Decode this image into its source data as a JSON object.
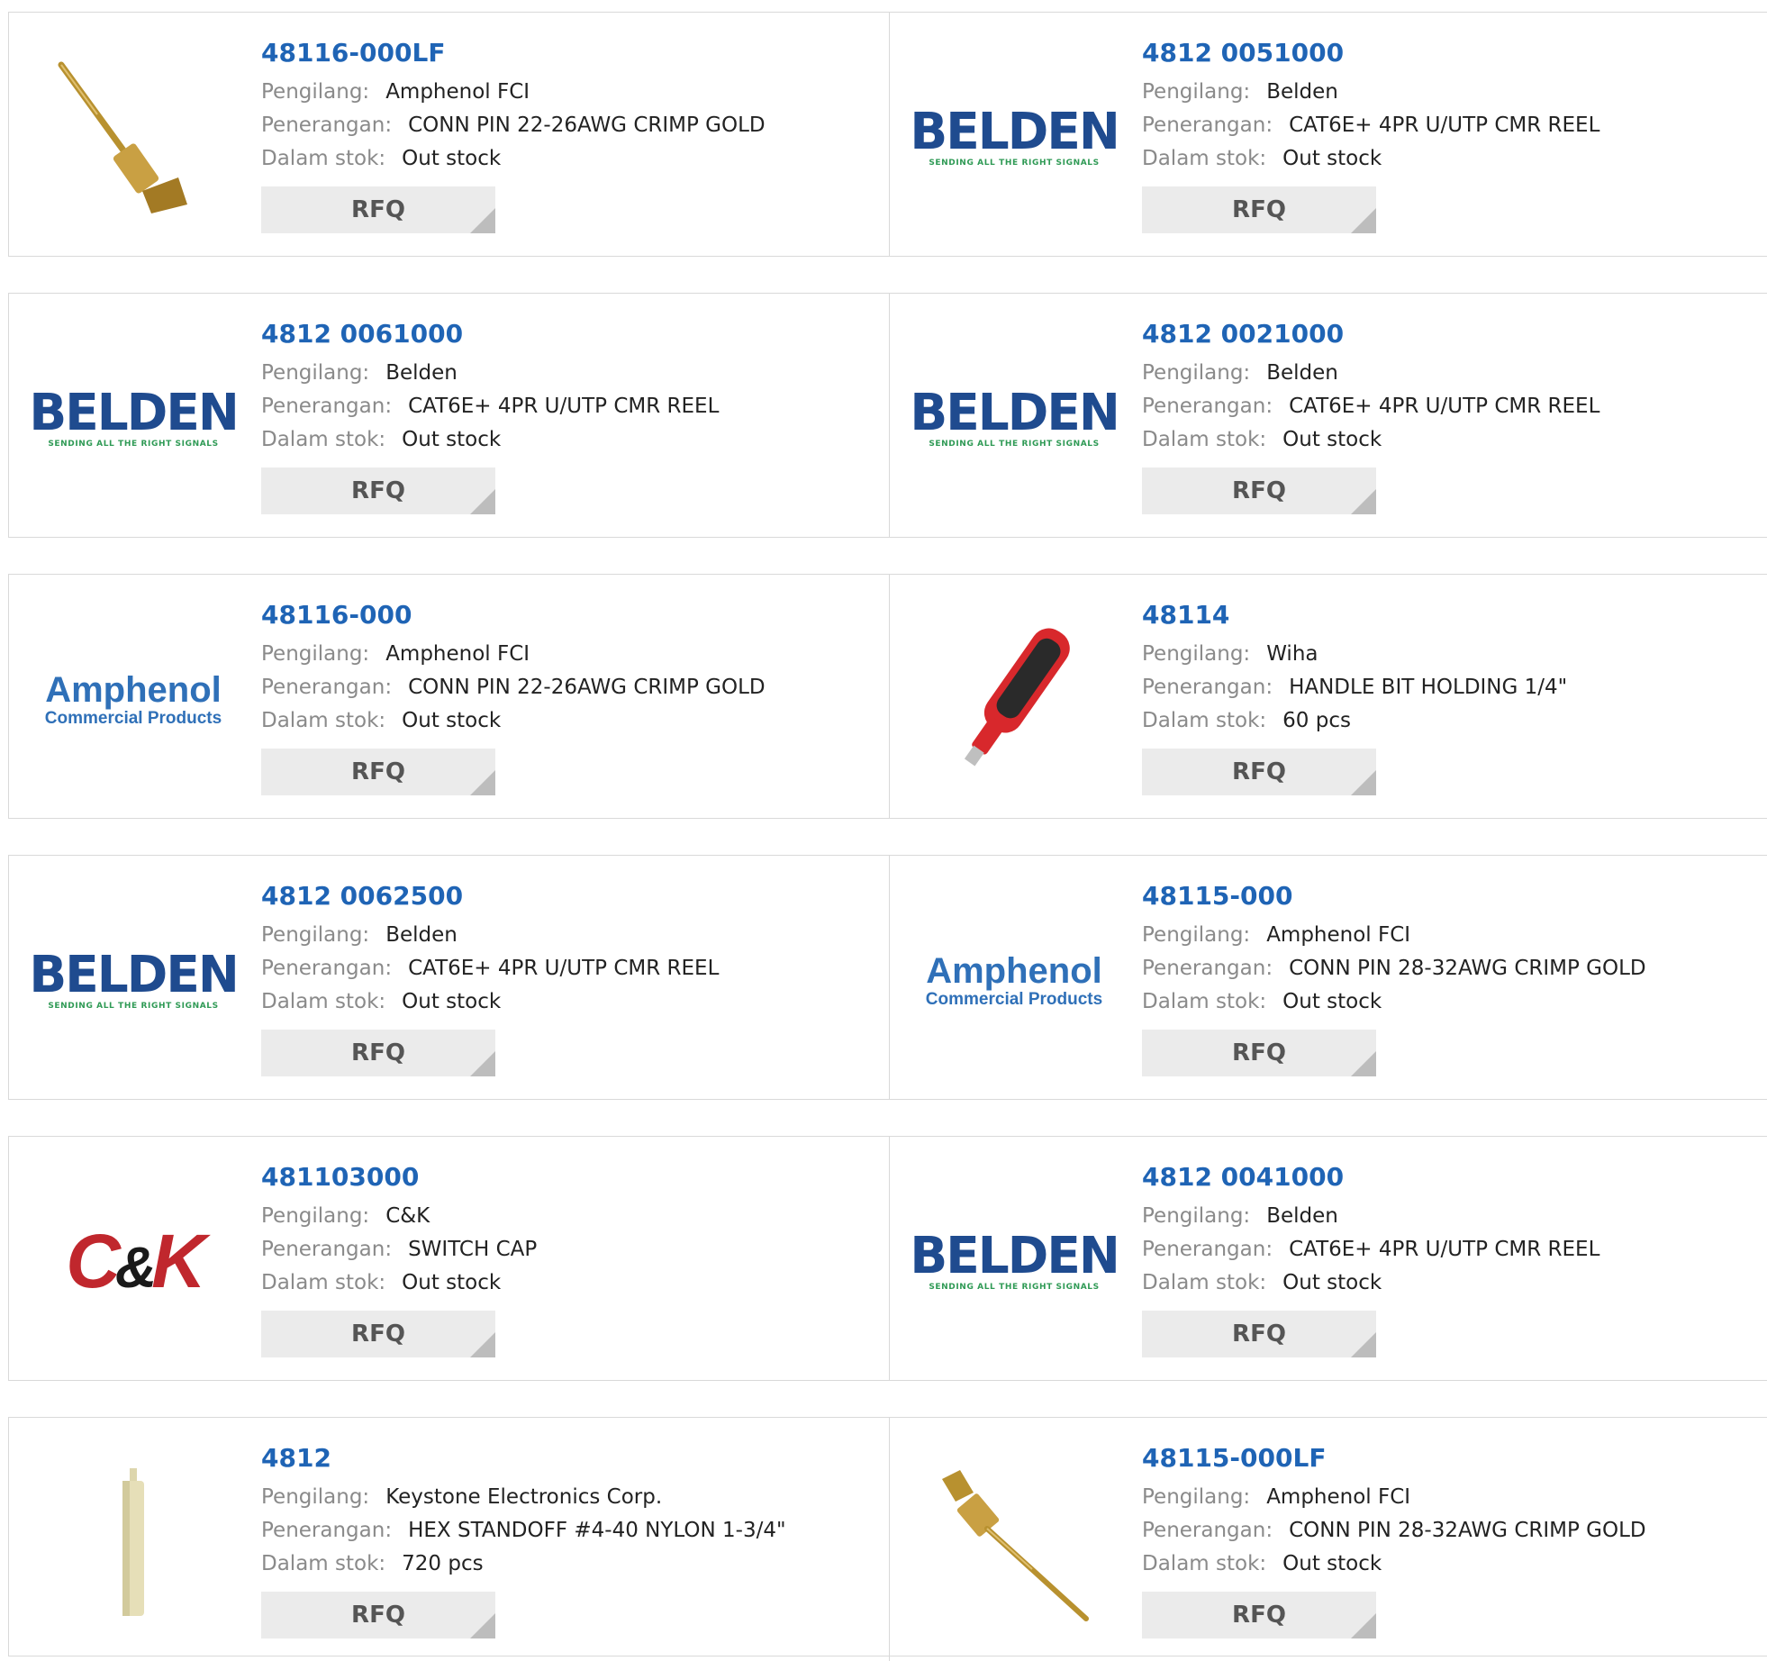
{
  "labels": {
    "manufacturer": "Pengilang:",
    "description": "Penerangan:",
    "stock": "Dalam stok:",
    "rfq": "RFQ"
  },
  "products": [
    {
      "part": "48116-000LF",
      "manufacturer": "Amphenol FCI",
      "description": "CONN PIN 22-26AWG CRIMP GOLD",
      "stock": "Out stock",
      "image": "crimp-pin-photo"
    },
    {
      "part": "4812 0051000",
      "manufacturer": "Belden",
      "description": "CAT6E+ 4PR U/UTP CMR REEL",
      "stock": "Out stock",
      "image": "belden-logo"
    },
    {
      "part": "4812 0061000",
      "manufacturer": "Belden",
      "description": "CAT6E+ 4PR U/UTP CMR REEL",
      "stock": "Out stock",
      "image": "belden-logo"
    },
    {
      "part": "4812 0021000",
      "manufacturer": "Belden",
      "description": "CAT6E+ 4PR U/UTP CMR REEL",
      "stock": "Out stock",
      "image": "belden-logo"
    },
    {
      "part": "48116-000",
      "manufacturer": "Amphenol FCI",
      "description": "CONN PIN 22-26AWG CRIMP GOLD",
      "stock": "Out stock",
      "image": "amphenol-logo"
    },
    {
      "part": "48114",
      "manufacturer": "Wiha",
      "description": "HANDLE BIT HOLDING 1/4\"",
      "stock": "60 pcs",
      "image": "screwdriver-handle-photo"
    },
    {
      "part": "4812 0062500",
      "manufacturer": "Belden",
      "description": "CAT6E+ 4PR U/UTP CMR REEL",
      "stock": "Out stock",
      "image": "belden-logo"
    },
    {
      "part": "48115-000",
      "manufacturer": "Amphenol FCI",
      "description": "CONN PIN 28-32AWG CRIMP GOLD",
      "stock": "Out stock",
      "image": "amphenol-logo"
    },
    {
      "part": "481103000",
      "manufacturer": "C&K",
      "description": "SWITCH CAP",
      "stock": "Out stock",
      "image": "ck-logo"
    },
    {
      "part": "4812 0041000",
      "manufacturer": "Belden",
      "description": "CAT6E+ 4PR U/UTP CMR REEL",
      "stock": "Out stock",
      "image": "belden-logo"
    },
    {
      "part": "4812",
      "manufacturer": "Keystone Electronics Corp.",
      "description": "HEX STANDOFF #4-40 NYLON 1-3/4\"",
      "stock": "720 pcs",
      "image": "standoff-photo"
    },
    {
      "part": "48115-000LF",
      "manufacturer": "Amphenol FCI",
      "description": "CONN PIN 28-32AWG CRIMP GOLD",
      "stock": "Out stock",
      "image": "crimp-pin-photo"
    }
  ],
  "logos": {
    "belden": {
      "word": "BELDEN",
      "tagline": "SENDING ALL THE RIGHT SIGNALS"
    },
    "amphenol": {
      "word": "Amphenol",
      "sub": "Commercial Products"
    },
    "ck": {
      "c": "C",
      "amp": "&",
      "k": "K"
    }
  },
  "colors": {
    "part_link": "#1f64b5",
    "label": "#8a8a8a",
    "rfq_bg": "#ebebeb",
    "border": "#d9d9d9"
  }
}
